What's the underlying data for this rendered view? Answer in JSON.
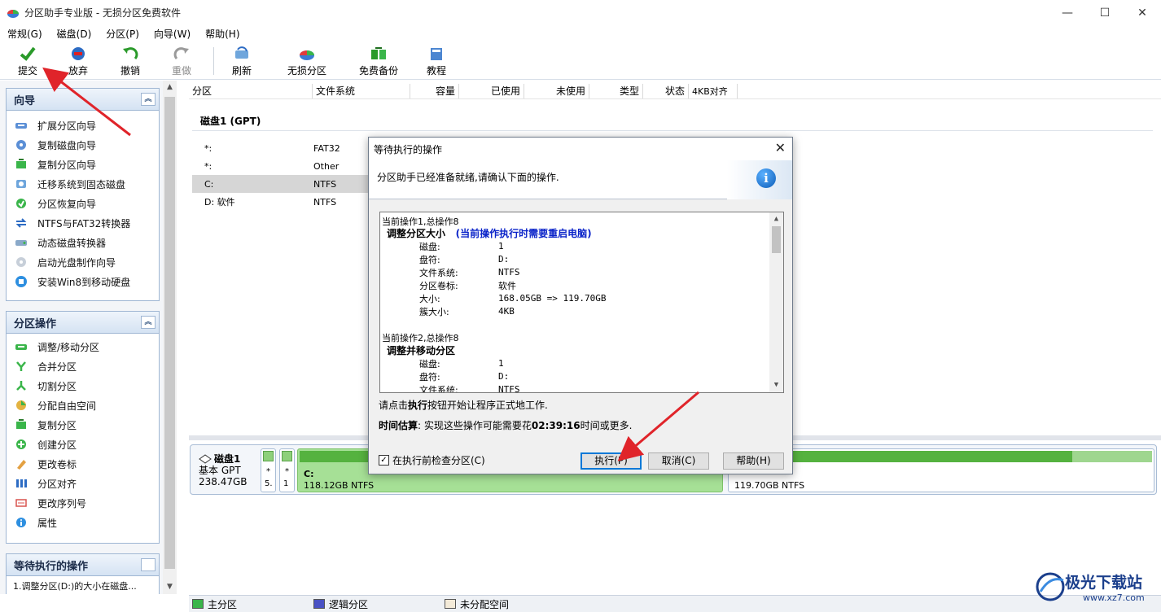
{
  "window": {
    "title": "分区助手专业版 - 无损分区免费软件",
    "controls": [
      "—",
      "☐",
      "✕"
    ]
  },
  "menu": [
    "常规(G)",
    "磁盘(D)",
    "分区(P)",
    "向导(W)",
    "帮助(H)"
  ],
  "toolbar": {
    "submit": "提交",
    "discard": "放弃",
    "undo": "撤销",
    "redo": "重做",
    "refresh": "刷新",
    "lossless": "无损分区",
    "backup": "免费备份",
    "tutorial": "教程"
  },
  "wizard_group": {
    "title": "向导",
    "items": [
      "扩展分区向导",
      "复制磁盘向导",
      "复制分区向导",
      "迁移系统到固态磁盘",
      "分区恢复向导",
      "NTFS与FAT32转换器",
      "动态磁盘转换器",
      "启动光盘制作向导",
      "安装Win8到移动硬盘"
    ]
  },
  "partition_group": {
    "title": "分区操作",
    "items": [
      "调整/移动分区",
      "合并分区",
      "切割分区",
      "分配自由空间",
      "复制分区",
      "创建分区",
      "更改卷标",
      "分区对齐",
      "更改序列号",
      "属性"
    ]
  },
  "pending_group": {
    "title": "等待执行的操作",
    "items": [
      "1.调整分区(D:)的大小在磁盘..."
    ]
  },
  "columns": [
    "分区",
    "文件系统",
    "容量",
    "已使用",
    "未使用",
    "类型",
    "状态",
    "4KB对齐"
  ],
  "disk": {
    "title": "磁盘1 (GPT)",
    "rows": [
      {
        "name": "*:",
        "fs": "FAT32"
      },
      {
        "name": "*:",
        "fs": "Other"
      },
      {
        "name": "C:",
        "fs": "NTFS"
      },
      {
        "name": "D: 软件",
        "fs": "NTFS"
      }
    ]
  },
  "diskmap": {
    "name": "磁盘1",
    "type": "基本 GPT",
    "size": "238.47GB",
    "small1": {
      "star": "*",
      "val": "5."
    },
    "small2": {
      "star": "*",
      "val": "1"
    },
    "c_name": "C:",
    "c_size": "118.12GB NTFS",
    "d_size": "119.70GB NTFS",
    "d_used_fraction": 0.81
  },
  "legend": [
    "主分区",
    "逻辑分区",
    "未分配空间"
  ],
  "dialog": {
    "title": "等待执行的操作",
    "message": "分区助手已经准备就绪,请确认下面的操作.",
    "log": {
      "op1_header": "当前操作1,总操作8",
      "op1_title": "调整分区大小",
      "op1_warn": "(当前操作执行时需要重启电脑)",
      "op1_fields": [
        {
          "k": "磁盘:",
          "v": "1"
        },
        {
          "k": "盘符:",
          "v": "D:"
        },
        {
          "k": "文件系统:",
          "v": "NTFS"
        },
        {
          "k": "分区卷标:",
          "v": "软件"
        },
        {
          "k": "大小:",
          "v": "168.05GB => 119.70GB"
        },
        {
          "k": "簇大小:",
          "v": "4KB"
        }
      ],
      "op2_header": "当前操作2,总操作8",
      "op2_title": "调整并移动分区",
      "op2_fields": [
        {
          "k": "磁盘:",
          "v": "1"
        },
        {
          "k": "盘符:",
          "v": "D:"
        },
        {
          "k": "文件系统:",
          "v": "NTFS"
        }
      ]
    },
    "note_prefix": "请点击",
    "note_bold": "执行",
    "note_suffix": "按钮开始让程序正式地工作.",
    "est_label": "时间估算",
    "est_prefix": ": 实现这些操作可能需要花",
    "est_time": "02:39:16",
    "est_suffix": "时间或更多.",
    "check_label": "在执行前检查分区(C)",
    "btn_execute": "执行(P)",
    "btn_cancel": "取消(C)",
    "btn_help": "帮助(H)"
  },
  "watermark": {
    "text": "极光下载站",
    "url": "www.xz7.com"
  },
  "colors": {
    "primary": "#55b23f",
    "accent": "#0078d7",
    "warn": "#0b24c9",
    "arrow": "#e0242a"
  }
}
